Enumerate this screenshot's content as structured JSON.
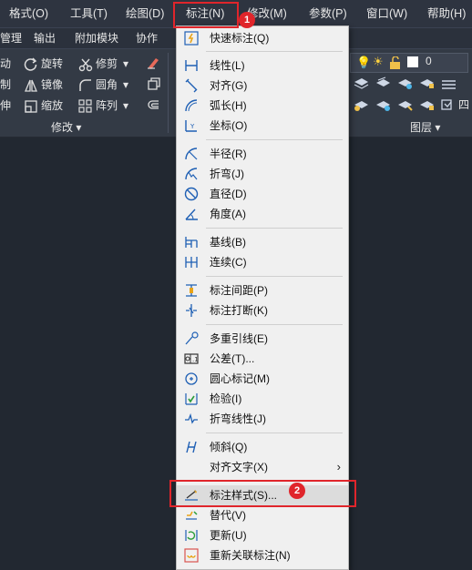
{
  "menubar": {
    "items": [
      "格式(O)",
      "工具(T)",
      "绘图(D)",
      "标注(N)",
      "修改(M)",
      "参数(P)",
      "窗口(W)",
      "帮助(H)"
    ]
  },
  "ribbon_tabs": [
    "管理",
    "输出",
    "附加模块",
    "协作"
  ],
  "ribbon": {
    "modify_cmds": [
      "动",
      "旋转",
      "修剪",
      "制",
      "镜像",
      "圆角",
      "伸",
      "缩放",
      "阵列"
    ],
    "modify_title": "修改",
    "layer_value": "0",
    "layer_title": "图层",
    "layer_edge": "四"
  },
  "dim_menu": {
    "items": [
      {
        "label": "快速标注(Q)",
        "icon": "quick-dimension-icon"
      },
      {
        "label": "线性(L)",
        "icon": "linear-icon"
      },
      {
        "label": "对齐(G)",
        "icon": "aligned-icon"
      },
      {
        "label": "弧长(H)",
        "icon": "arc-length-icon"
      },
      {
        "label": "坐标(O)",
        "icon": "ordinate-icon"
      },
      {
        "label": "半径(R)",
        "icon": "radius-icon"
      },
      {
        "label": "折弯(J)",
        "icon": "jogged-icon"
      },
      {
        "label": "直径(D)",
        "icon": "diameter-icon"
      },
      {
        "label": "角度(A)",
        "icon": "angular-icon"
      },
      {
        "label": "基线(B)",
        "icon": "baseline-icon"
      },
      {
        "label": "连续(C)",
        "icon": "continue-icon"
      },
      {
        "label": "标注间距(P)",
        "icon": "dim-space-icon"
      },
      {
        "label": "标注打断(K)",
        "icon": "dim-break-icon"
      },
      {
        "label": "多重引线(E)",
        "icon": "multileader-icon"
      },
      {
        "label": "公差(T)...",
        "icon": "tolerance-icon"
      },
      {
        "label": "圆心标记(M)",
        "icon": "center-mark-icon"
      },
      {
        "label": "检验(I)",
        "icon": "inspect-icon"
      },
      {
        "label": "折弯线性(J)",
        "icon": "jogged-linear-icon"
      },
      {
        "label": "倾斜(Q)",
        "icon": "oblique-icon"
      },
      {
        "label": "对齐文字(X)",
        "icon": ""
      },
      {
        "label": "标注样式(S)...",
        "icon": "dim-style-icon"
      },
      {
        "label": "替代(V)",
        "icon": "override-icon"
      },
      {
        "label": "更新(U)",
        "icon": "update-icon"
      },
      {
        "label": "重新关联标注(N)",
        "icon": "reassociate-icon"
      }
    ]
  },
  "annotations": {
    "step1": "1",
    "step2": "2"
  },
  "colors": {
    "accent_red": "#e0252b",
    "menu_bg": "#f0f0f0",
    "dark_bg": "#222831"
  }
}
